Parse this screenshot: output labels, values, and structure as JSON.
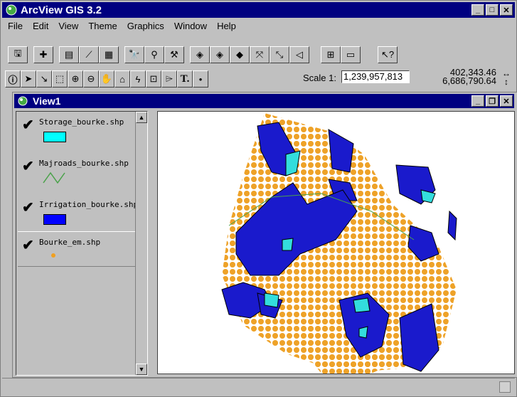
{
  "app": {
    "title": "ArcView GIS 3.2"
  },
  "menu": [
    "File",
    "Edit",
    "View",
    "Theme",
    "Graphics",
    "Window",
    "Help"
  ],
  "scale": {
    "label": "Scale 1:",
    "value": "1,239,957,813"
  },
  "coords": {
    "x": "402,343.46",
    "y": "6,686,790.64"
  },
  "view": {
    "title": "View1"
  },
  "toc": [
    {
      "name": "Storage_bourke.shp",
      "symbol": "polygon",
      "color": "#00ffff"
    },
    {
      "name": "Majroads_bourke.shp",
      "symbol": "line",
      "color": "#4aa24a"
    },
    {
      "name": "Irrigation_bourke.shp",
      "symbol": "polygon",
      "color": "#0000ff"
    },
    {
      "name": "Bourke_em.shp",
      "symbol": "point",
      "color": "#f0a020"
    }
  ],
  "colors": {
    "title_bg": "#000080",
    "window_bg": "#c0c0c0",
    "irrigation": "#1a1acc",
    "storage": "#33dddd",
    "points": "#eea228"
  }
}
